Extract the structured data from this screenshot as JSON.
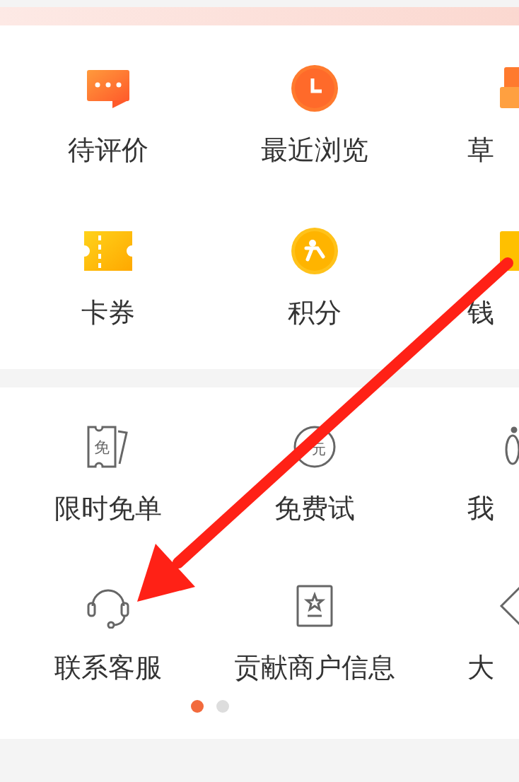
{
  "sections": [
    {
      "items": [
        {
          "label": "待评价"
        },
        {
          "label": "最近浏览"
        },
        {
          "label": "草"
        },
        {
          "label": "卡券"
        },
        {
          "label": "积分"
        },
        {
          "label": "钱"
        }
      ]
    },
    {
      "items": [
        {
          "label": "限时免单",
          "icon_text": "免"
        },
        {
          "label": "免费试",
          "icon_text": "元"
        },
        {
          "label": "我"
        },
        {
          "label": "联系客服"
        },
        {
          "label": "贡献商户信息"
        },
        {
          "label": "大"
        }
      ],
      "pager": [
        {
          "selected": true
        },
        {
          "selected": false
        }
      ]
    }
  ]
}
